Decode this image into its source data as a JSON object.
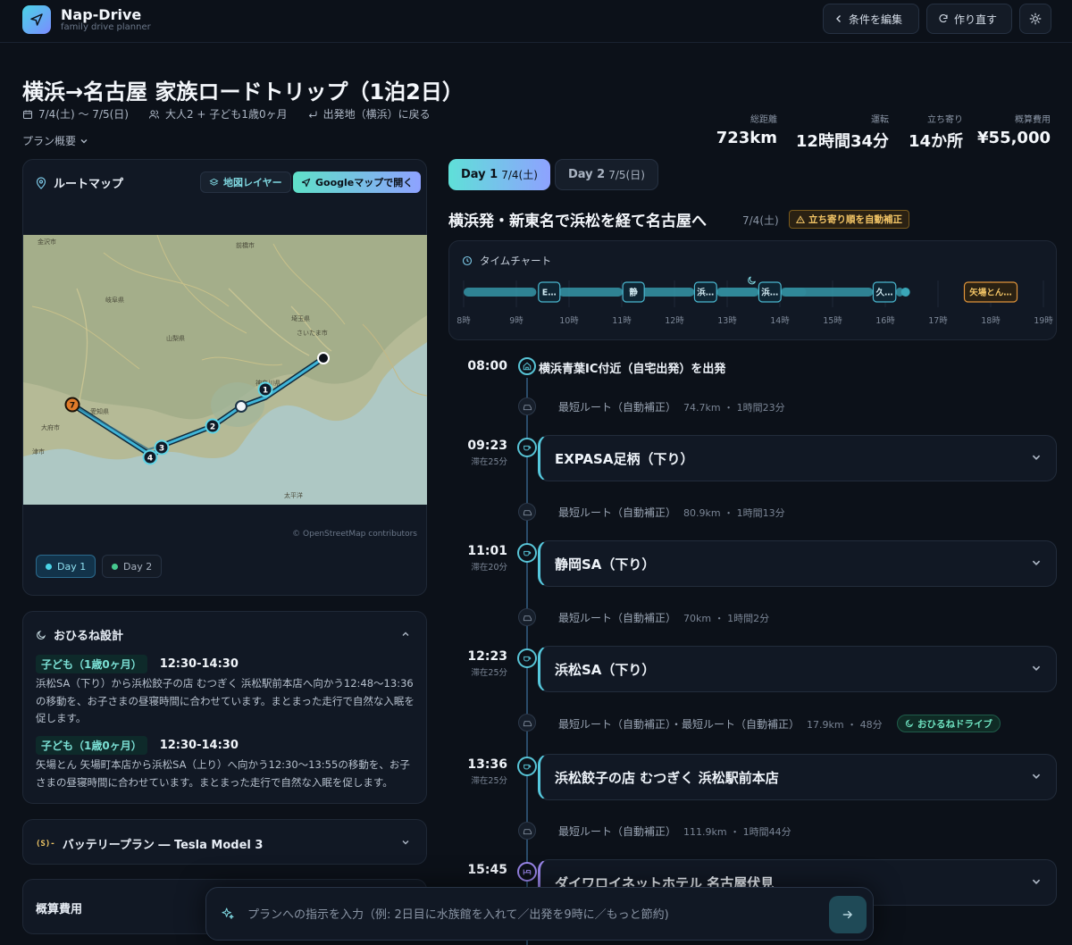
{
  "header": {
    "brand": "Nap-Drive",
    "tagline": "family drive planner",
    "edit_label": "条件を編集",
    "rebuild_label": "作り直す"
  },
  "plan": {
    "title": "横浜→名古屋 家族ロードトリップ（1泊2日）",
    "dates": "7/4(土) 〜 7/5(日)",
    "party": "大人2 + 子ども1歳0ヶ月",
    "return_note": "出発地（横浜）に戻る",
    "overview_label": "プラン概要"
  },
  "stats": [
    {
      "label": "総距離",
      "value": "723km"
    },
    {
      "label": "運転",
      "value": "12時間34分"
    },
    {
      "label": "立ち寄り",
      "value": "14か所"
    },
    {
      "label": "概算費用",
      "value": "¥55,000"
    }
  ],
  "map_card": {
    "title": "ルートマップ",
    "layer_label": "地図レイヤー",
    "google_label": "Googleマップで開く",
    "attribution": "© OpenStreetMap contributors",
    "day_tabs": [
      "Day 1",
      "Day 2"
    ],
    "markers": [
      "1",
      "2",
      "3",
      "4",
      "7"
    ]
  },
  "nap_card": {
    "title": "おひるね設計",
    "entries": [
      {
        "child": "子ども（1歳0ヶ月）",
        "time": "12:30-14:30",
        "text": "浜松SA（下り）から浜松餃子の店 むつぎく 浜松駅前本店へ向かう12:48〜13:36の移動を、お子さまの昼寝時間に合わせています。まとまった走行で自然な入眠を促します。"
      },
      {
        "child": "子ども（1歳0ヶ月）",
        "time": "12:30-14:30",
        "text": "矢場とん 矢場町本店から浜松SA（上り）へ向かう12:30〜13:55の移動を、お子さまの昼寝時間に合わせています。まとまった走行で自然な入眠を促します。"
      }
    ]
  },
  "battery_card": {
    "title": "バッテリープラン ― Tesla Model 3"
  },
  "cost_card": {
    "title": "概算費用"
  },
  "day_tabs": [
    {
      "day": "Day 1",
      "date": "7/4(土)"
    },
    {
      "day": "Day 2",
      "date": "7/5(日)"
    }
  ],
  "day": {
    "title": "横浜発・新東名で浜松を経て名古屋へ",
    "date": "7/4(土)",
    "warning": "立ち寄り順を自動補正"
  },
  "timechart": {
    "title": "タイムチャート",
    "hours": [
      "8時",
      "9時",
      "10時",
      "11時",
      "12時",
      "13時",
      "14時",
      "15時",
      "16時",
      "17時",
      "18時",
      "19時"
    ],
    "stops": [
      {
        "label": "E…",
        "start": 9.42,
        "end": 9.8
      },
      {
        "label": "静",
        "start": 11.02,
        "end": 11.35
      },
      {
        "label": "浜…",
        "start": 12.38,
        "end": 12.8
      },
      {
        "label": "浜…",
        "start": 13.6,
        "end": 14.02
      },
      {
        "label": "久…",
        "start": 15.77,
        "end": 16.2
      },
      {
        "label": "矢場とん…",
        "start": 17.5,
        "end": 18.5
      }
    ],
    "drives": [
      {
        "start": 8.0,
        "end": 9.38
      },
      {
        "start": 9.8,
        "end": 11.02
      },
      {
        "start": 11.35,
        "end": 12.38
      },
      {
        "start": 12.8,
        "end": 13.6
      },
      {
        "start": 14.02,
        "end": 15.77
      },
      {
        "start": 16.2,
        "end": 16.35
      }
    ],
    "nap": {
      "start": 12.5,
      "end": 14.5
    }
  },
  "timeline": {
    "start": {
      "time": "08:00",
      "label": "横浜青葉IC付近（自宅出発）を出発"
    },
    "segments": [
      {
        "route": "最短ルート（自動補正）",
        "dist": "74.7km ・ 1時間23分"
      },
      {
        "route": "最短ルート（自動補正）",
        "dist": "80.9km ・ 1時間13分"
      },
      {
        "route": "最短ルート（自動補正）",
        "dist": "70km ・ 1時間2分"
      },
      {
        "route": "最短ルート（自動補正）・最短ルート（自動補正）",
        "dist": "17.9km ・ 48分",
        "badge": "おひるねドライブ"
      },
      {
        "route": "最短ルート（自動補正）",
        "dist": "111.9km ・ 1時間44分"
      }
    ],
    "stops": [
      {
        "time": "09:23",
        "stay": "滞在25分",
        "name": "EXPASA足柄（下り）"
      },
      {
        "time": "11:01",
        "stay": "滞在20分",
        "name": "静岡SA（下り）"
      },
      {
        "time": "12:23",
        "stay": "滞在25分",
        "name": "浜松SA（下り）"
      },
      {
        "time": "13:36",
        "stay": "滞在25分",
        "name": "浜松餃子の店 むつぎく 浜松駅前本店"
      },
      {
        "time": "15:45",
        "stay": "",
        "name": "ダイワロイネットホテル 名古屋伏見"
      }
    ]
  },
  "command": {
    "placeholder": "プランへの指示を入力（例: 2日目に水族館を入れて／出発を9時に／もっと節約)"
  },
  "colors": {
    "accent": "#4ad3e6",
    "accent2": "#7b8cff",
    "bg": "#0c1119",
    "warn": "#f3c566",
    "nap": "#6fe3c1"
  }
}
